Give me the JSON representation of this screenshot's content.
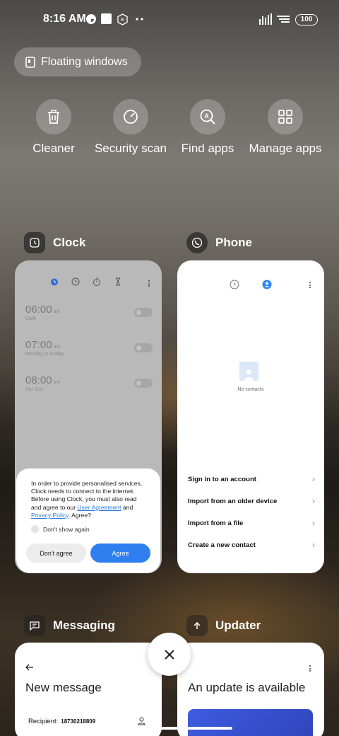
{
  "status_bar": {
    "time": "8:16 AM",
    "battery": "100",
    "left_icons": [
      "app-notification-icon",
      "square-notification-icon",
      "ri-notification-icon",
      "more-dots-icon"
    ],
    "right_icons": [
      "signal-icon",
      "wifi-icon",
      "battery-icon"
    ]
  },
  "floating_windows": {
    "label": "Floating windows",
    "icon": "floating-window-icon"
  },
  "quick_actions": [
    {
      "label": "Cleaner",
      "icon": "trash-icon"
    },
    {
      "label": "Security scan",
      "icon": "security-scan-icon"
    },
    {
      "label": "Find apps",
      "icon": "find-apps-icon"
    },
    {
      "label": "Manage apps",
      "icon": "manage-apps-icon"
    }
  ],
  "apps": {
    "clock": {
      "name": "Clock",
      "alarms": [
        {
          "time": "06:00",
          "ampm": "am",
          "repeat": "Daily"
        },
        {
          "time": "07:00",
          "ampm": "am",
          "repeat": "Monday to Friday"
        },
        {
          "time": "08:00",
          "ampm": "am",
          "repeat": "Sat Sun"
        }
      ],
      "dialog": {
        "text_before": "In order to provide personalised services, Clock needs to connect to the internet. Before using Clock, you must also read and agree to our ",
        "link_user_agreement": "User Agreement",
        "text_and": " and ",
        "link_privacy": "Privacy Policy",
        "text_after": ". Agree?",
        "dont_show": "Don't show again",
        "disagree": "Don't agree",
        "agree": "Agree"
      }
    },
    "phone": {
      "name": "Phone",
      "empty_label": "No contacts",
      "options": [
        "Sign in to an account",
        "Import from an older device",
        "Import from a file",
        "Create a new contact"
      ]
    },
    "messaging": {
      "name": "Messaging",
      "title": "New message",
      "recipient_label": "Recipient:",
      "recipient_number": "18730218809"
    },
    "updater": {
      "name": "Updater",
      "title": "An update is available"
    }
  },
  "colors": {
    "accent": "#2f7ff0",
    "clock_active_tab": "#2f6fd8"
  }
}
